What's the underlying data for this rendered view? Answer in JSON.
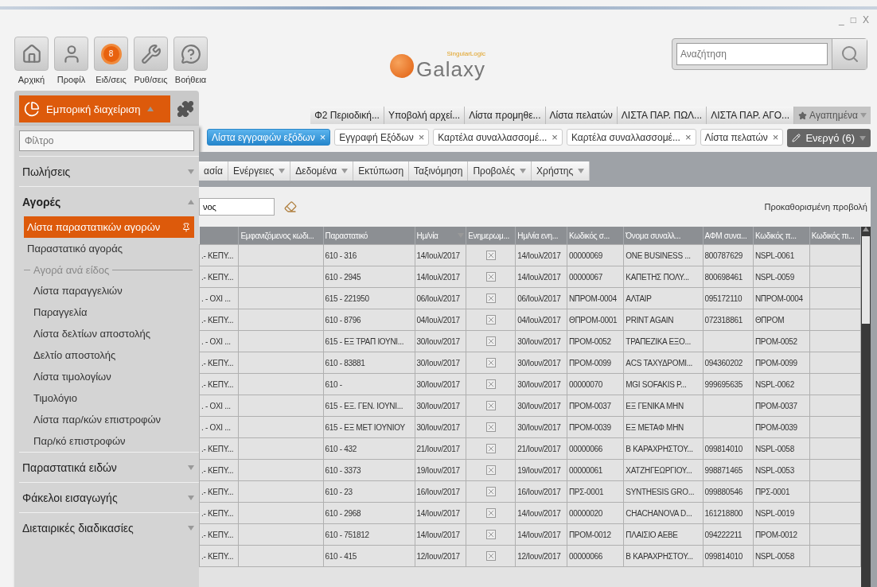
{
  "window": {
    "controls": [
      "_",
      "□",
      "X"
    ]
  },
  "toolbar": [
    {
      "kind": "home",
      "label": "Αρχική"
    },
    {
      "kind": "profile",
      "label": "Προφίλ"
    },
    {
      "kind": "notifications",
      "label": "Ειδ/σεις",
      "badge": "8"
    },
    {
      "kind": "settings",
      "label": "Ρυθ/σεις"
    },
    {
      "kind": "help",
      "label": "Βοήθεια"
    }
  ],
  "logo": {
    "vendor": "SingularLogic",
    "name": "Galaxy"
  },
  "search": {
    "placeholder": "Αναζήτηση"
  },
  "module": {
    "label": "Εμπορική διαχείριση",
    "expanded": true
  },
  "favorites": {
    "items": [
      "Φ2 Περιοδική...",
      "Υποβολή αρχεί...",
      "Λίστα προμηθε...",
      "Λίστα πελατών",
      "ΛΙΣΤΑ ΠΑΡ. ΠΩΛ...",
      "ΛΙΣΤΑ ΠΑΡ. ΑΓΟ..."
    ],
    "menu": "Αγαπημένα"
  },
  "open_tabs": {
    "tabs": [
      {
        "label": "Λίστα εγγραφών εξόδων",
        "selected": true
      },
      {
        "label": "Εγγραφή Εξόδων",
        "selected": false
      },
      {
        "label": "Καρτέλα συναλλασσομέ...",
        "selected": false
      },
      {
        "label": "Καρτέλα συναλλασσομέ...",
        "selected": false
      },
      {
        "label": "Λίστα πελατών",
        "selected": false
      }
    ],
    "close": "×",
    "active": "Ενεργό (6)"
  },
  "sidebar": {
    "filter_placeholder": "Φίλτρο",
    "sections": [
      {
        "label": "Πωλήσεις",
        "expanded": false
      },
      {
        "label": "Αγορές",
        "expanded": true,
        "items": [
          {
            "kind": "link",
            "label": "Λίστα παραστατικών αγορών",
            "selected": true
          },
          {
            "kind": "link",
            "label": "Παραστατικό αγοράς",
            "selected": false
          },
          {
            "kind": "group",
            "label": "Αγορά ανά είδος",
            "children": [
              {
                "label": "Λίστα παραγγελιών",
                "selected": false
              },
              {
                "label": "Παραγγελία",
                "selected": false
              },
              {
                "label": "Λίστα δελτίων αποστολής",
                "selected": false
              },
              {
                "label": "Δελτίο αποστολής",
                "selected": false
              },
              {
                "label": "Λίστα τιμολογίων",
                "selected": false
              },
              {
                "label": "Τιμολόγιο",
                "selected": false
              },
              {
                "label": "Λίστα παρ/κών επιστροφών",
                "selected": false
              },
              {
                "label": "Παρ/κό επιστροφών",
                "selected": false
              }
            ]
          }
        ]
      },
      {
        "label": "Παραστατικά ειδών",
        "expanded": false
      },
      {
        "label": "Φάκελοι εισαγωγής",
        "expanded": false
      },
      {
        "label": "Διεταιρικές διαδικασίες",
        "expanded": false
      }
    ]
  },
  "menu_bar": [
    {
      "label": "ασία",
      "dropdown": false
    },
    {
      "label": "Ενέργειες",
      "dropdown": true
    },
    {
      "label": "Δεδομένα",
      "dropdown": true
    },
    {
      "label": "Εκτύπωση",
      "dropdown": false
    },
    {
      "label": "Ταξινόμηση",
      "dropdown": false
    },
    {
      "label": "Προβολές",
      "dropdown": true
    },
    {
      "label": "Χρήστης",
      "dropdown": true
    }
  ],
  "filter": {
    "value": "νος",
    "view": "Προκαθορισμένη προβολή"
  },
  "table": {
    "columns": [
      {
        "label": "Εμφανιζόμενος κωδι...",
        "sorted": false
      },
      {
        "label": "Παραστατικό",
        "sorted": false
      },
      {
        "label": "Ημ/νία",
        "sorted": true
      },
      {
        "label": "Ενημερωμ...",
        "sorted": false
      },
      {
        "label": "Ημ/νία ενη...",
        "sorted": false
      },
      {
        "label": "Κωδικός σ...",
        "sorted": false
      },
      {
        "label": "Όνομα συναλλ...",
        "sorted": false
      },
      {
        "label": "ΑΦΜ συνα...",
        "sorted": false
      },
      {
        "label": "Κωδικός π...",
        "sorted": false
      },
      {
        "label": "Κωδικός πι...",
        "sorted": false
      }
    ],
    "rows": [
      {
        "column_1": ".- ΚΕΠΥ...",
        "document": "610 - 316",
        "date": "14/Ιουλ/2017",
        "updated": true,
        "update_date": "14/Ιουλ/2017",
        "code": "00000069",
        "name": "ONE BUSINESS ...",
        "vat": "800787629",
        "code_2": "NSPL-0061"
      },
      {
        "column_1": ".- ΚΕΠΥ...",
        "document": "610 - 2945",
        "date": "14/Ιουλ/2017",
        "updated": true,
        "update_date": "14/Ιουλ/2017",
        "code": "00000067",
        "name": "ΚΑΠΕΤΗΣ ΠΟΛΥ...",
        "vat": "800698461",
        "code_2": "NSPL-0059"
      },
      {
        "column_1": ". - ΟΧΙ ...",
        "document": "615 - 221950",
        "date": "06/Ιουλ/2017",
        "updated": true,
        "update_date": "06/Ιουλ/2017",
        "code": "ΝΠΡΟΜ-0004",
        "name": "ΑΛΤΑΙΡ",
        "vat": "095172110",
        "code_2": "ΝΠΡΟΜ-0004"
      },
      {
        "column_1": ".- ΚΕΠΥ...",
        "document": "610 - 8796",
        "date": "04/Ιουλ/2017",
        "updated": true,
        "update_date": "04/Ιουλ/2017",
        "code": "ΘΠΡΟΜ-0001",
        "name": "PRINT AGAIN",
        "vat": "072318861",
        "code_2": "ΘΠΡΟΜ"
      },
      {
        "column_1": ". - ΟΧΙ ...",
        "document": "615 - ΕΞ ΤΡΑΠ ΙΟΥΝΙ...",
        "date": "30/Ιουν/2017",
        "updated": true,
        "update_date": "30/Ιουν/2017",
        "code": "ΠΡΟΜ-0052",
        "name": "ΤΡΑΠΕΖΙΚΑ ΕΞΟ...",
        "code_2": "ΠΡΟΜ-0052"
      },
      {
        "column_1": ".- ΚΕΠΥ...",
        "document": "610 - 83881",
        "date": "30/Ιουν/2017",
        "updated": true,
        "update_date": "30/Ιουν/2017",
        "code": "ΠΡΟΜ-0099",
        "name": "ACS ΤΑΧΥΔΡΟΜΙ...",
        "vat": "094360202",
        "code_2": "ΠΡΟΜ-0099"
      },
      {
        "column_1": ".- ΚΕΠΥ...",
        "document": "610 -",
        "date": "30/Ιουν/2017",
        "updated": true,
        "update_date": "30/Ιουν/2017",
        "code": "00000070",
        "name": "MGI SOFAKIS P...",
        "vat": "999695635",
        "code_2": "NSPL-0062"
      },
      {
        "column_1": ". - ΟΧΙ ...",
        "document": "615 - ΕΞ. ΓΕΝ. ΙΟΥΝΙ...",
        "date": "30/Ιουν/2017",
        "updated": true,
        "update_date": "30/Ιουν/2017",
        "code": "ΠΡΟΜ-0037",
        "name": "ΕΞ ΓΕΝΙΚΑ ΜΗΝ",
        "code_2": "ΠΡΟΜ-0037"
      },
      {
        "column_1": ". - ΟΧΙ ...",
        "document": "615 - ΕΞ ΜΕΤ ΙΟΥΝΙΟΥ",
        "date": "30/Ιουν/2017",
        "updated": true,
        "update_date": "30/Ιουν/2017",
        "code": "ΠΡΟΜ-0039",
        "name": "ΕΞ ΜΕΤΑΦ ΜΗΝ",
        "code_2": "ΠΡΟΜ-0039"
      },
      {
        "column_1": ".- ΚΕΠΥ...",
        "document": "610 - 432",
        "date": "21/Ιουν/2017",
        "updated": true,
        "update_date": "21/Ιουν/2017",
        "code": "00000066",
        "name": "Β ΚΑΡΑΧΡΗΣΤΟΥ...",
        "vat": "099814010",
        "code_2": "NSPL-0058"
      },
      {
        "column_1": ".- ΚΕΠΥ...",
        "document": "610 - 3373",
        "date": "19/Ιουν/2017",
        "updated": true,
        "update_date": "19/Ιουν/2017",
        "code": "00000061",
        "name": "ΧΑΤΖΗΓΕΩΡΓΙΟΥ...",
        "vat": "998871465",
        "code_2": "NSPL-0053"
      },
      {
        "column_1": ".- ΚΕΠΥ...",
        "document": "610 - 23",
        "date": "16/Ιουν/2017",
        "updated": true,
        "update_date": "16/Ιουν/2017",
        "code": "ΠΡΣ-0001",
        "name": "SYNTHESIS GRO...",
        "vat": "099880546",
        "code_2": "ΠΡΣ-0001"
      },
      {
        "column_1": ".- ΚΕΠΥ...",
        "document": "610 - 2968",
        "date": "14/Ιουν/2017",
        "updated": true,
        "update_date": "14/Ιουν/2017",
        "code": "00000020",
        "name": "CHACHANOVA D...",
        "vat": "161218800",
        "code_2": "NSPL-0019"
      },
      {
        "column_1": ".- ΚΕΠΥ...",
        "document": "610 - 751812",
        "date": "14/Ιουν/2017",
        "updated": true,
        "update_date": "14/Ιουν/2017",
        "code": "ΠΡΟΜ-0012",
        "name": "ΠΛΑΙΣΙΟ ΑΕΒΕ",
        "vat": "094222211",
        "code_2": "ΠΡΟΜ-0012"
      },
      {
        "column_1": ".- ΚΕΠΥ...",
        "document": "610 - 415",
        "date": "12/Ιουν/2017",
        "updated": true,
        "update_date": "12/Ιουν/2017",
        "code": "00000066",
        "name": "Β ΚΑΡΑΧΡΗΣΤΟΥ...",
        "vat": "099814010",
        "code_2": "NSPL-0058"
      }
    ]
  }
}
